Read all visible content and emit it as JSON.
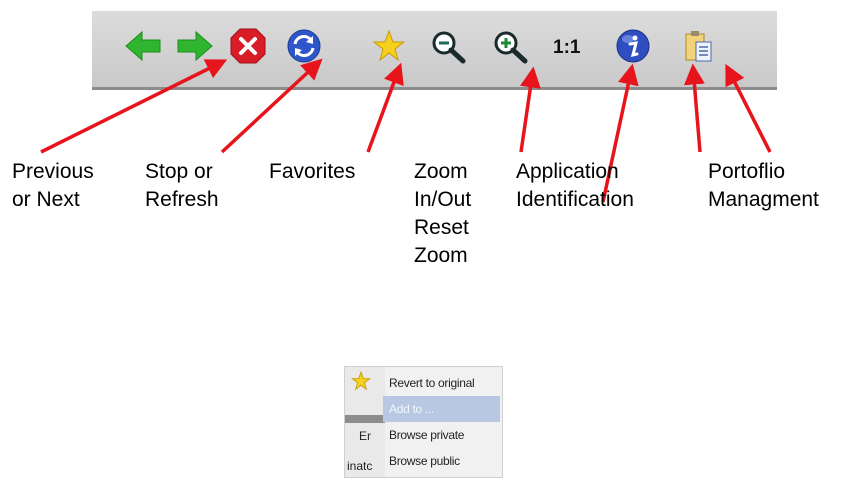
{
  "toolbar": {
    "icons": [
      "previous-arrow-icon",
      "next-arrow-icon",
      "stop-icon",
      "refresh-icon",
      "favorites-star-icon",
      "zoom-out-icon",
      "zoom-in-icon",
      "reset-zoom",
      "info-icon",
      "portfolio-icon"
    ],
    "reset_zoom_label": "1:1"
  },
  "annotations": {
    "prev_next": [
      "Previous",
      "or Next"
    ],
    "stop_refresh": [
      "Stop or",
      "Refresh"
    ],
    "favorites": [
      "Favorites"
    ],
    "zoom": [
      "Zoom",
      "In/Out",
      "Reset",
      "Zoom"
    ],
    "app_id": [
      "Application",
      "Identification"
    ],
    "portfolio": [
      "Portoflio",
      "Managment"
    ]
  },
  "colors": {
    "arrow": "#e8141b",
    "nav_green": "#2fb52f",
    "stop_red": "#d81c28",
    "refresh_blue": "#2f56c9",
    "star_yellow": "#f7cf1d",
    "menu_selected": "#b8c8e3"
  },
  "menu": {
    "items": [
      {
        "label": "Revert to original",
        "selected": false
      },
      {
        "label": "Add to ...",
        "selected": true
      },
      {
        "label": "Browse private",
        "selected": false
      },
      {
        "label": "Browse public",
        "selected": false
      }
    ],
    "fragments": {
      "tab": "Er",
      "bottom": "inatc"
    }
  }
}
